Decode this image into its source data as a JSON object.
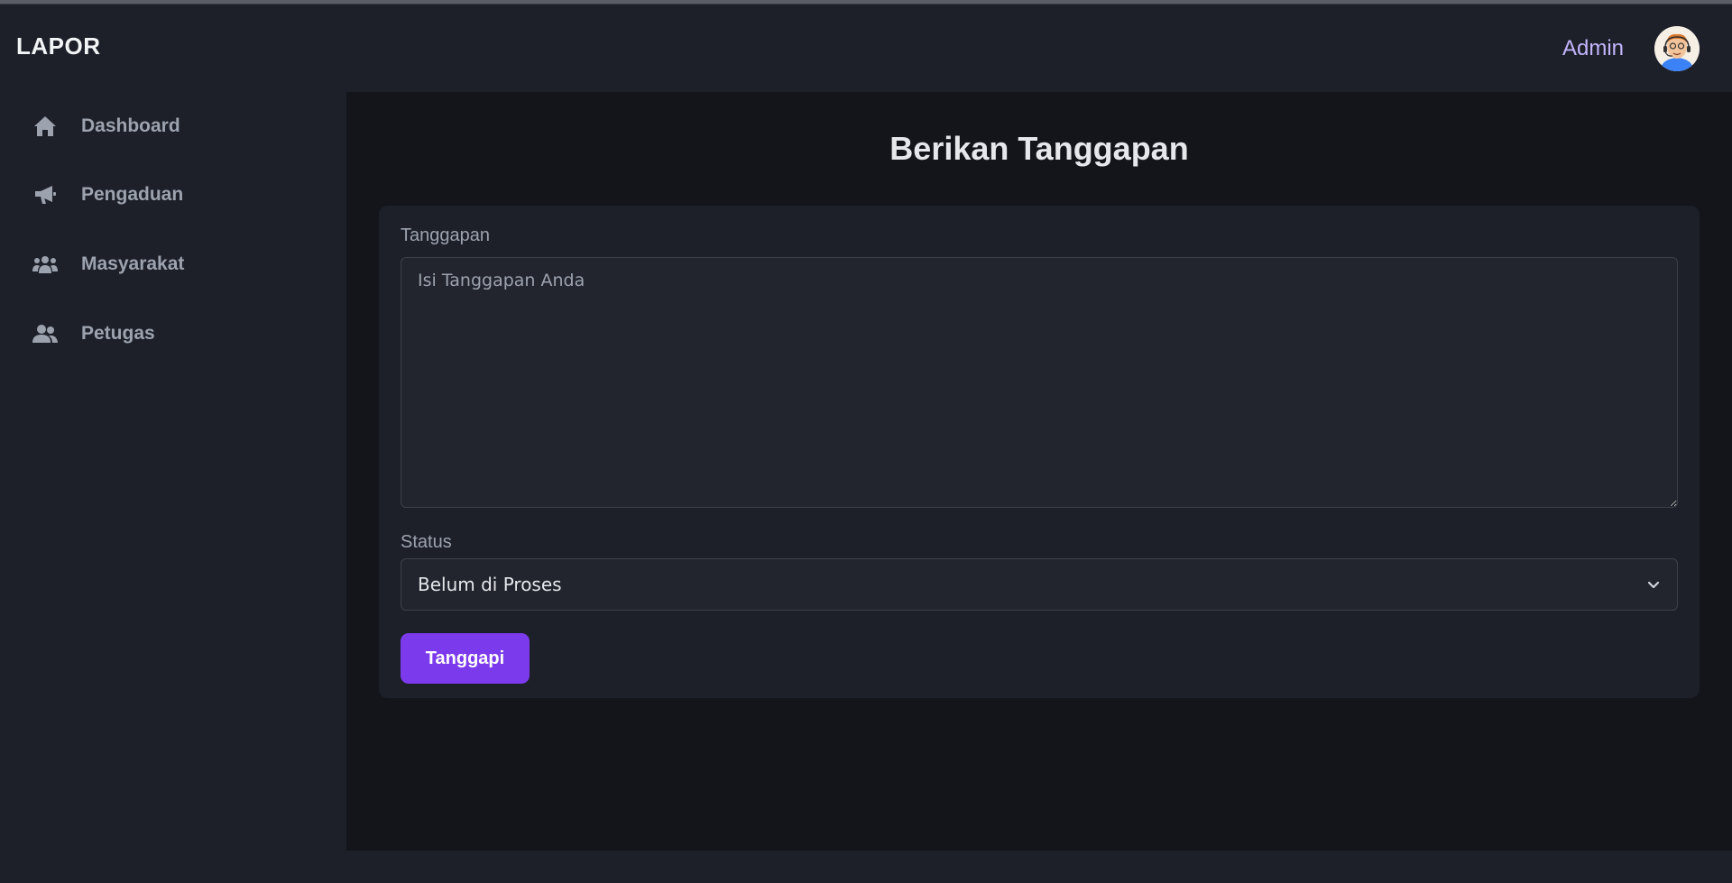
{
  "app": {
    "brand": "LAPOR"
  },
  "header": {
    "user_name": "Admin"
  },
  "sidebar": {
    "items": [
      {
        "label": "Dashboard",
        "icon": "home-icon"
      },
      {
        "label": "Pengaduan",
        "icon": "megaphone-icon"
      },
      {
        "label": "Masyarakat",
        "icon": "users-icon"
      },
      {
        "label": "Petugas",
        "icon": "user-group-icon"
      }
    ]
  },
  "main": {
    "title": "Berikan Tanggapan",
    "form": {
      "response_label": "Tanggapan",
      "response_placeholder": "Isi Tanggapan Anda",
      "response_value": "",
      "status_label": "Status",
      "status_selected": "Belum di Proses",
      "submit_label": "Tanggapi"
    }
  },
  "colors": {
    "accent": "#7c3aed",
    "user_name": "#c4b5fd",
    "background": "#1d2029",
    "main_background": "#13151a"
  }
}
